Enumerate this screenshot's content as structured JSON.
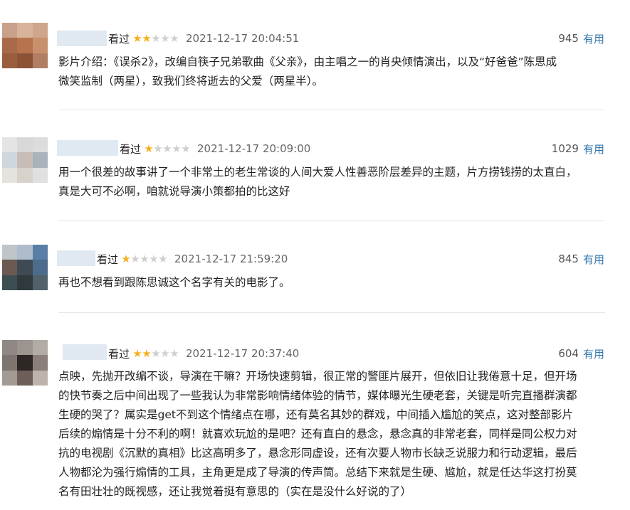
{
  "colors": {
    "star_on": "#f5b01c",
    "star_off": "#cfcfcf",
    "useful_link": "#3377aa"
  },
  "comments": [
    {
      "watched_label": "看过",
      "rating": 2,
      "time": "2021-12-17 20:04:51",
      "votes": "945",
      "useful_label": "有用",
      "lines": [
        "影片介绍：《误杀2》，改编自筷子兄弟歌曲《父亲》，由主唱之一的肖央倾情演出，以及“好爸爸”陈思成",
        "微笑监制（两星），致我们终将逝去的父爱（两星半）。"
      ]
    },
    {
      "watched_label": "看过",
      "rating": 1,
      "time": "2021-12-17 20:09:00",
      "votes": "1029",
      "useful_label": "有用",
      "lines": [
        "用一个很差的故事讲了一个非常土的老生常谈的人间大爱人性善恶阶层差异的主题，片方捞钱捞的太直白，",
        "真是大可不必啊，咱就说导演小策都拍的比这好"
      ]
    },
    {
      "watched_label": "看过",
      "rating": 1,
      "time": "2021-12-17 21:59:20",
      "votes": "845",
      "useful_label": "有用",
      "lines": [
        "再也不想看到跟陈思诚这个名字有关的电影了。"
      ]
    },
    {
      "watched_label": "看过",
      "rating": 2,
      "time": "2021-12-17 20:37:40",
      "votes": "604",
      "useful_label": "有用",
      "lines": [
        "点映，先抛开改编不谈，导演在干嘛？开场快速剪辑，很正常的警匪片展开，但依旧让我倦意十足，但开场",
        "的快节奏之后中间出现了一些我认为非常影响情绪体验的情节，媒体曝光生硬老套，关键是听完直播群演都",
        "生硬的哭了？属实是get不到这个情绪点在哪，还有莫名其妙的群戏，中间插入尴尬的笑点，这对整部影片",
        "后续的煽情是十分不利的啊！就喜欢玩尬的是吧？还有直白的悬念，悬念真的非常老套，同样是同公权力对",
        "抗的电视剧《沉默的真相》比这高明多了，悬念形同虚设，还有次要人物市长缺乏说服力和行动逻辑，最后",
        "人物都沦为强行煽情的工具，主角更是成了导演的传声筒。总结下来就是生硬、尴尬，就是任达华这打扮莫",
        "名有田壮壮的既视感，还让我觉着挺有意思的（实在是没什么好说的了）"
      ]
    }
  ]
}
